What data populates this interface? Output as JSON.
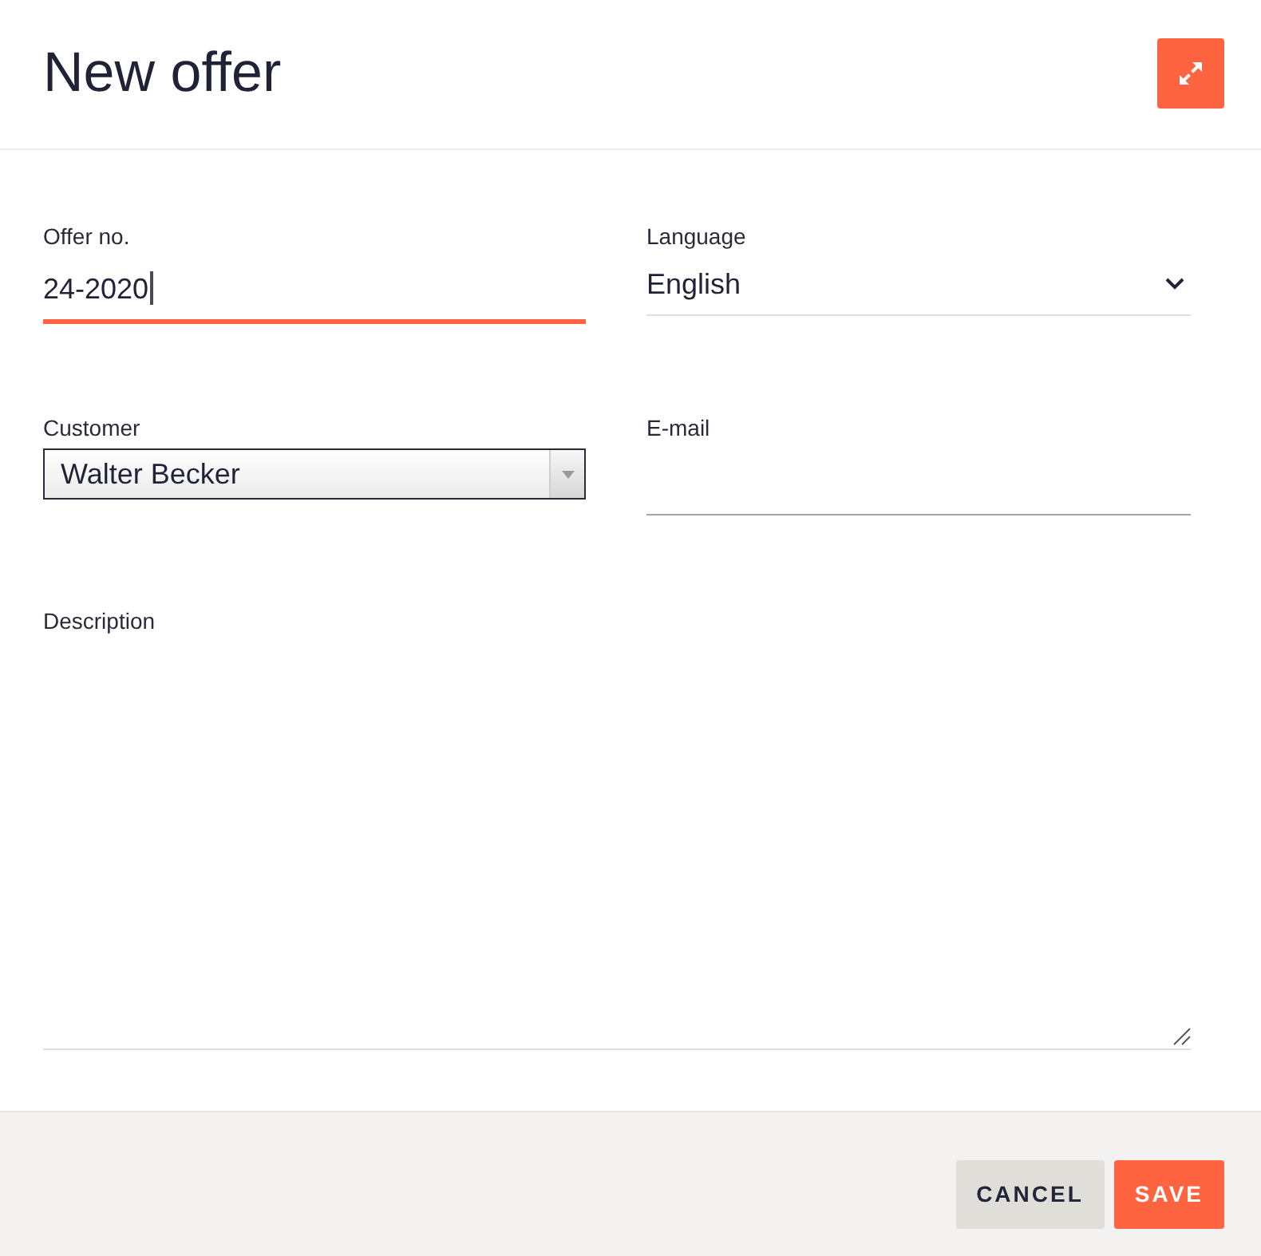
{
  "dialog": {
    "title": "New offer"
  },
  "fields": [
    {
      "kind": "text",
      "label": "Offer no.",
      "value": "24-2020",
      "focused": true
    },
    {
      "kind": "dropdown",
      "label": "Language",
      "value": "English",
      "focused": false
    },
    {
      "kind": "combobox",
      "label": "Customer",
      "value": "Walter Becker",
      "focused": false
    },
    {
      "kind": "text",
      "label": "E-mail",
      "focused": false
    },
    {
      "kind": "textarea",
      "label": "Description",
      "focused": false
    }
  ],
  "buttons": [
    {
      "label": "CANCEL",
      "kind": "secondary"
    },
    {
      "label": "SAVE",
      "kind": "primary"
    }
  ]
}
